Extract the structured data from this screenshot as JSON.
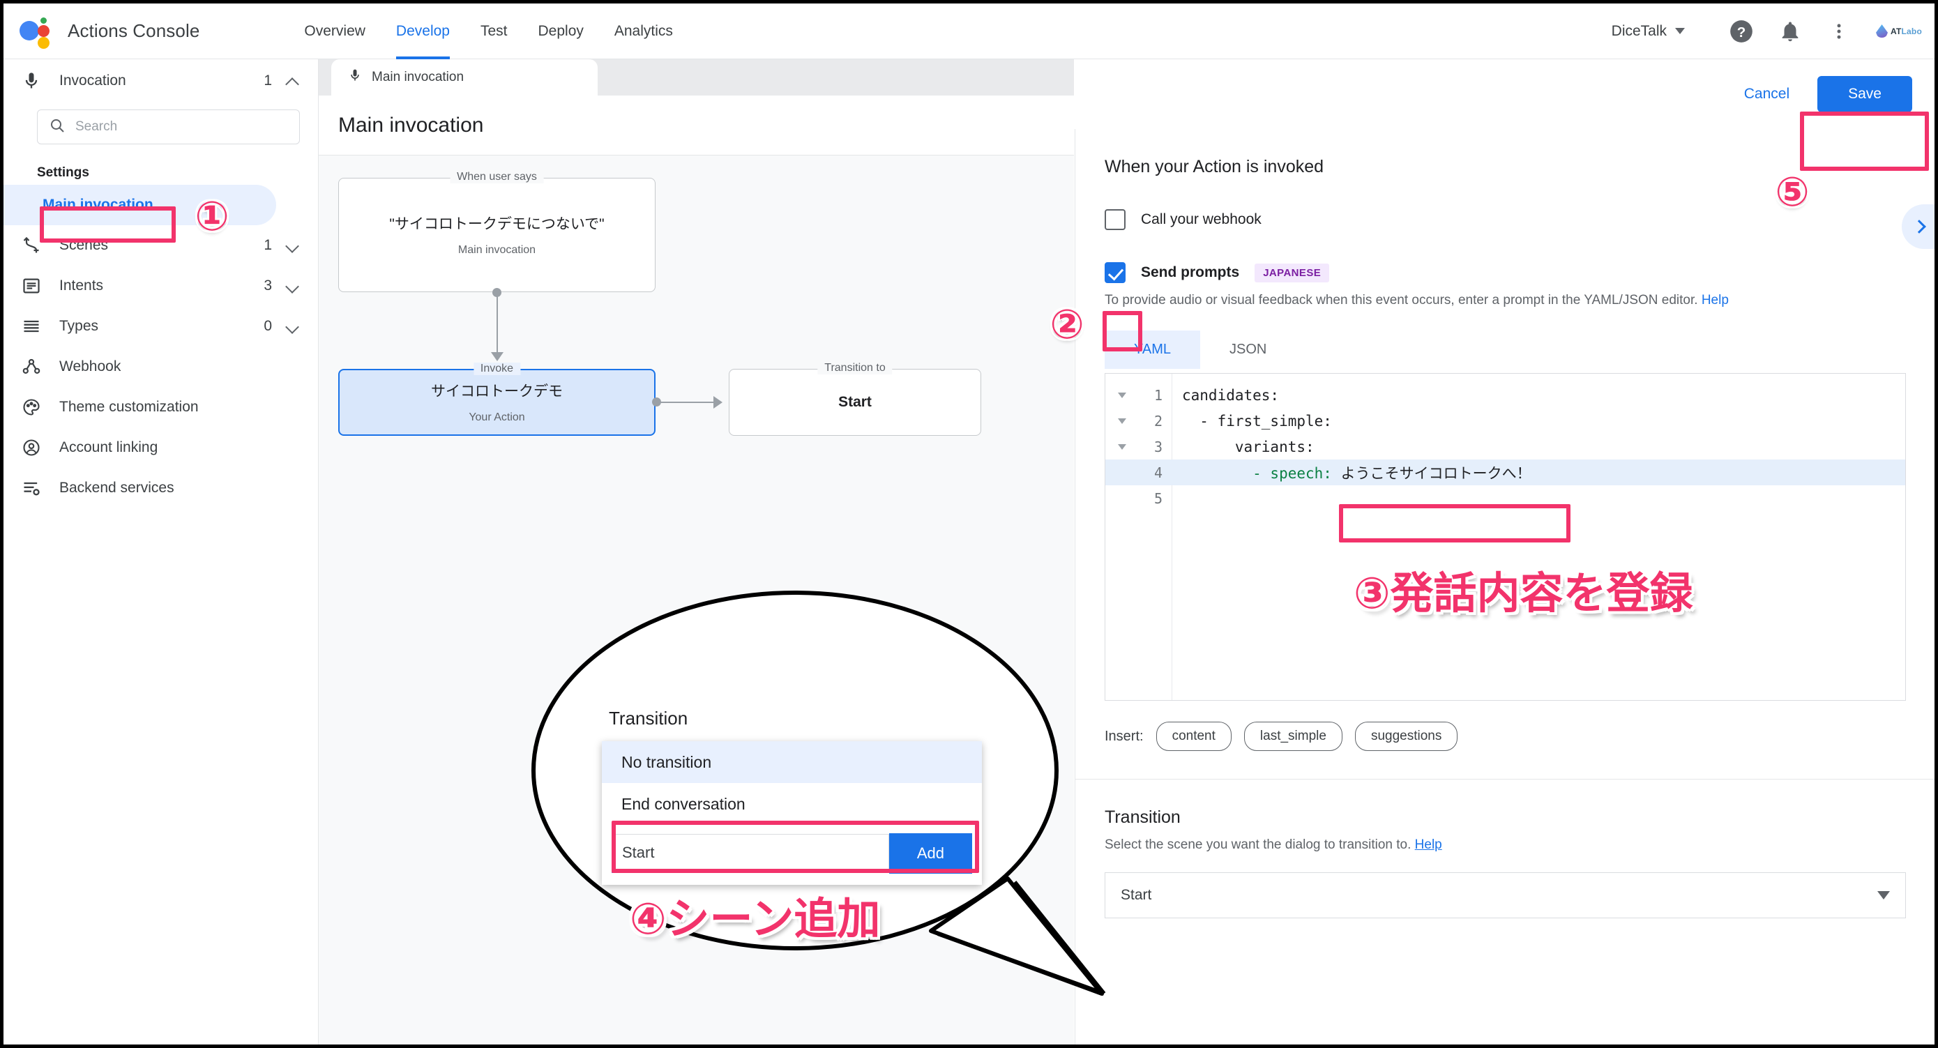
{
  "header": {
    "app_title": "Actions Console",
    "nav": [
      {
        "label": "Overview",
        "active": false
      },
      {
        "label": "Develop",
        "active": true
      },
      {
        "label": "Test",
        "active": false
      },
      {
        "label": "Deploy",
        "active": false
      },
      {
        "label": "Analytics",
        "active": false
      }
    ],
    "project_name": "DiceTalk",
    "help_icon": "help-circle-icon",
    "notifications_icon": "bell-icon",
    "more_icon": "more-vertical-icon",
    "brand_logo_text_1": "AT",
    "brand_logo_text_2": "Labo"
  },
  "sidebar": {
    "invocation": {
      "label": "Invocation",
      "count": "1"
    },
    "search": {
      "placeholder": "Search",
      "value": ""
    },
    "settings_label": "Settings",
    "items": [
      {
        "label": "Main invocation",
        "count": "",
        "icon": "",
        "selected": true
      },
      {
        "label": "Scenes",
        "count": "1",
        "icon": "scenes-icon",
        "selected": false
      },
      {
        "label": "Intents",
        "count": "3",
        "icon": "intents-icon",
        "selected": false
      },
      {
        "label": "Types",
        "count": "0",
        "icon": "types-icon",
        "selected": false
      },
      {
        "label": "Webhook",
        "count": "",
        "icon": "webhook-icon",
        "selected": false
      },
      {
        "label": "Theme customization",
        "count": "",
        "icon": "palette-icon",
        "selected": false
      },
      {
        "label": "Account linking",
        "count": "",
        "icon": "account-icon",
        "selected": false
      },
      {
        "label": "Backend services",
        "count": "",
        "icon": "backend-icon",
        "selected": false
      }
    ]
  },
  "center": {
    "tab_label": "Main invocation",
    "tab_icon": "microphone-icon",
    "page_title": "Main invocation",
    "nodes": [
      {
        "legend": "When user says",
        "main": "\"サイコロトークデモにつないで\"",
        "sub": "Main invocation"
      },
      {
        "legend": "Invoke",
        "main": "サイコロトークデモ",
        "sub": "Your Action"
      },
      {
        "legend": "Transition to",
        "main": "Start",
        "sub": ""
      }
    ]
  },
  "right": {
    "cancel_label": "Cancel",
    "save_label": "Save",
    "section_title": "When your Action is invoked",
    "webhook_checkbox": {
      "label": "Call your webhook",
      "checked": false
    },
    "prompts_checkbox": {
      "label": "Send prompts",
      "checked": true,
      "lang_chip": "JAPANESE"
    },
    "hint_text": "To provide audio or visual feedback when this event occurs, enter a prompt in the YAML/JSON editor.",
    "hint_link": "Help",
    "editor_tabs": [
      {
        "label": "YAML",
        "active": true
      },
      {
        "label": "JSON",
        "active": false
      }
    ],
    "code_lines": [
      {
        "num": "1",
        "fold": true,
        "key": "candidates",
        "value": "",
        "indent": 0,
        "dash": false,
        "highlight": false
      },
      {
        "num": "2",
        "fold": true,
        "key": "first_simple",
        "value": "",
        "indent": 1,
        "dash": true,
        "highlight": false
      },
      {
        "num": "3",
        "fold": true,
        "key": "variants",
        "value": "",
        "indent": 2,
        "dash": false,
        "highlight": false
      },
      {
        "num": "4",
        "fold": false,
        "key": "speech",
        "value": "ようこそサイコロトークへ！",
        "indent": 3,
        "dash": true,
        "highlight": true
      },
      {
        "num": "5",
        "fold": false,
        "key": "",
        "value": "",
        "indent": 0,
        "dash": false,
        "highlight": false
      }
    ],
    "code_raw": {
      "line1": "candidates:",
      "line2": "  - first_simple:",
      "line3": "      variants:",
      "line4_key": "        - speech: ",
      "line4_val": "ようこそサイコロトークへ！"
    },
    "insert_label": "Insert:",
    "insert_chips": [
      "content",
      "last_simple",
      "suggestions"
    ],
    "transition": {
      "title": "Transition",
      "hint": "Select the scene you want the dialog to transition to.",
      "hint_link": "Help",
      "selected": "Start"
    },
    "expand_icon": "chevron-right-icon"
  },
  "callout": {
    "title": "Transition",
    "hint": "Select the scene you want the dialog to transition to.",
    "hint_link": "Help",
    "options": [
      {
        "label": "No transition",
        "highlight": true
      },
      {
        "label": "End conversation",
        "highlight": false
      }
    ],
    "input_value": "Start",
    "add_button": "Add"
  },
  "annotations": {
    "marker1": "①",
    "marker2": "②",
    "marker3": "③",
    "marker5": "⑤",
    "text3": "③発話内容を登録",
    "text4": "④シーン追加",
    "accent_color": "#f2336b"
  }
}
